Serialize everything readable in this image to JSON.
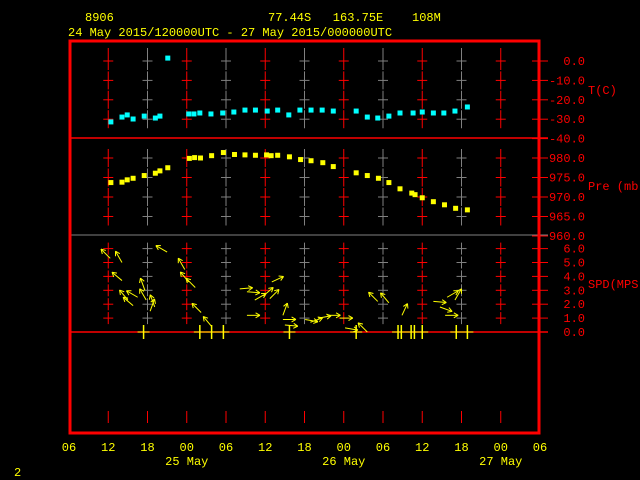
{
  "header": {
    "station": "8906",
    "location": "77.44S   163.75E    108M",
    "period": "24 May 2015/120000UTC - 27 May 2015/000000UTC"
  },
  "footer": {
    "page": "2"
  },
  "colors": {
    "frame": "#ff0000",
    "text": "#ffff00",
    "temperature": "#00ffff",
    "pressure": "#ffff00",
    "wind": "#ffff00",
    "grid_alt": "#808080"
  },
  "chart_data": [
    {
      "type": "scatter",
      "title": "T(C)",
      "ylabel": "T(C)",
      "x_units": "hours since 24 May 06UTC",
      "xlim": [
        0,
        72
      ],
      "ylim": [
        -40,
        0
      ],
      "yticks": [
        "0.0",
        "-10.0",
        "-20.0",
        "-30.0",
        "-40.0"
      ],
      "ytick_values": [
        0,
        -10,
        -20,
        -30,
        -40
      ],
      "points": [
        [
          6.4,
          -31.4
        ],
        [
          8.1,
          -28.9
        ],
        [
          8.9,
          -27.8
        ],
        [
          9.8,
          -29.9
        ],
        [
          11.5,
          -28.4
        ],
        [
          13.2,
          -29.4
        ],
        [
          13.9,
          -28.4
        ],
        [
          15.1,
          1.5
        ],
        [
          18.3,
          -27.3
        ],
        [
          19.1,
          -27.3
        ],
        [
          20.0,
          -26.8
        ],
        [
          21.7,
          -27.3
        ],
        [
          23.5,
          -26.8
        ],
        [
          25.2,
          -26.3
        ],
        [
          26.9,
          -25.3
        ],
        [
          28.5,
          -25.3
        ],
        [
          30.3,
          -25.8
        ],
        [
          31.9,
          -25.3
        ],
        [
          33.6,
          -27.8
        ],
        [
          35.3,
          -25.3
        ],
        [
          37.0,
          -25.3
        ],
        [
          38.7,
          -25.3
        ],
        [
          40.4,
          -25.8
        ],
        [
          43.9,
          -25.8
        ],
        [
          45.6,
          -28.9
        ],
        [
          47.2,
          -29.4
        ],
        [
          48.9,
          -28.4
        ],
        [
          50.6,
          -26.8
        ],
        [
          52.6,
          -26.8
        ],
        [
          54.0,
          -26.3
        ],
        [
          55.7,
          -26.8
        ],
        [
          57.3,
          -26.8
        ],
        [
          59.0,
          -25.8
        ],
        [
          60.9,
          -23.7
        ]
      ]
    },
    {
      "type": "scatter",
      "title": "Pre (mb)",
      "ylabel": "Pre (mb)",
      "xlim": [
        0,
        72
      ],
      "ylim": [
        960,
        980
      ],
      "yticks": [
        "980.0",
        "975.0",
        "970.0",
        "965.0",
        "960.0"
      ],
      "ytick_values": [
        980,
        975,
        970,
        965,
        960
      ],
      "points": [
        [
          6.4,
          973.7
        ],
        [
          8.1,
          973.8
        ],
        [
          8.9,
          974.4
        ],
        [
          9.8,
          974.8
        ],
        [
          11.5,
          975.5
        ],
        [
          13.2,
          976.1
        ],
        [
          13.9,
          976.7
        ],
        [
          15.1,
          977.5
        ],
        [
          18.4,
          979.9
        ],
        [
          19.2,
          980.1
        ],
        [
          20.1,
          980.0
        ],
        [
          21.8,
          980.6
        ],
        [
          23.6,
          981.4
        ],
        [
          25.3,
          980.9
        ],
        [
          26.9,
          980.8
        ],
        [
          28.5,
          980.7
        ],
        [
          30.2,
          980.8
        ],
        [
          30.9,
          980.6
        ],
        [
          31.9,
          980.7
        ],
        [
          33.7,
          980.3
        ],
        [
          35.4,
          979.6
        ],
        [
          37.0,
          979.3
        ],
        [
          38.8,
          978.8
        ],
        [
          40.4,
          977.8
        ],
        [
          43.9,
          976.2
        ],
        [
          45.6,
          975.5
        ],
        [
          47.3,
          974.8
        ],
        [
          48.9,
          973.7
        ],
        [
          50.6,
          972.1
        ],
        [
          52.4,
          971.0
        ],
        [
          52.9,
          970.6
        ],
        [
          54.0,
          969.8
        ],
        [
          55.7,
          968.8
        ],
        [
          57.4,
          968.0
        ],
        [
          59.1,
          967.1
        ],
        [
          60.9,
          966.7
        ]
      ]
    },
    {
      "type": "scatter",
      "title": "SPD(MPS)",
      "ylabel": "SPD(MPS)",
      "xlim": [
        0,
        72
      ],
      "ylim": [
        0,
        6
      ],
      "yticks": [
        "6.0",
        "5.0",
        "4.0",
        "3.0",
        "2.0",
        "1.0",
        "0.0"
      ],
      "ytick_values": [
        6,
        5,
        4,
        3,
        2,
        1,
        0
      ],
      "wind_arrows_hour_speed_direction_deg": [
        [
          6.3,
          5.3,
          315
        ],
        [
          8.1,
          5.0,
          330
        ],
        [
          8.1,
          3.7,
          310
        ],
        [
          9.0,
          2.3,
          320
        ],
        [
          9.8,
          1.9,
          310
        ],
        [
          10.5,
          2.5,
          300
        ],
        [
          11.6,
          3.0,
          340
        ],
        [
          11.8,
          2.3,
          330
        ],
        [
          12.4,
          1.5,
          20
        ],
        [
          13.1,
          1.8,
          340
        ],
        [
          15.0,
          5.75,
          300
        ],
        [
          17.7,
          4.5,
          330
        ],
        [
          18.3,
          3.6,
          320
        ],
        [
          19.3,
          3.2,
          315
        ],
        [
          20.2,
          1.4,
          315
        ],
        [
          21.8,
          0.4,
          320
        ],
        [
          26.1,
          3.1,
          85
        ],
        [
          27.2,
          2.9,
          95
        ],
        [
          27.2,
          1.2,
          90
        ],
        [
          28.4,
          2.3,
          60
        ],
        [
          29.7,
          2.6,
          50
        ],
        [
          30.7,
          2.4,
          45
        ],
        [
          31.0,
          3.6,
          65
        ],
        [
          32.7,
          1.2,
          20
        ],
        [
          32.7,
          0.9,
          90
        ],
        [
          33.0,
          0.5,
          95
        ],
        [
          36.1,
          0.9,
          100
        ],
        [
          36.9,
          0.7,
          70
        ],
        [
          38.1,
          1.0,
          80
        ],
        [
          39.5,
          1.2,
          90
        ],
        [
          41.4,
          1.0,
          90
        ],
        [
          42.2,
          0.3,
          100
        ],
        [
          45.6,
          0.0,
          315
        ],
        [
          47.2,
          2.2,
          315
        ],
        [
          48.9,
          2.1,
          320
        ],
        [
          50.9,
          1.2,
          25
        ],
        [
          55.7,
          2.2,
          95
        ],
        [
          56.7,
          1.8,
          110
        ],
        [
          57.5,
          1.2,
          90
        ],
        [
          57.8,
          2.5,
          60
        ],
        [
          59.0,
          2.3,
          30
        ]
      ],
      "calm_markers_hours": [
        11.4,
        20.0,
        21.8,
        23.6,
        33.7,
        43.9,
        50.3,
        50.8,
        52.3,
        52.8,
        54.0,
        59.2,
        60.9
      ]
    }
  ],
  "x_axis": {
    "tick_labels": [
      "06",
      "12",
      "18",
      "00",
      "06",
      "12",
      "18",
      "00",
      "06",
      "12",
      "18",
      "00",
      "06"
    ],
    "date_labels": [
      {
        "hour": 18,
        "label": "25 May"
      },
      {
        "hour": 42,
        "label": "26 May"
      },
      {
        "hour": 66,
        "label": "27 May"
      }
    ]
  }
}
